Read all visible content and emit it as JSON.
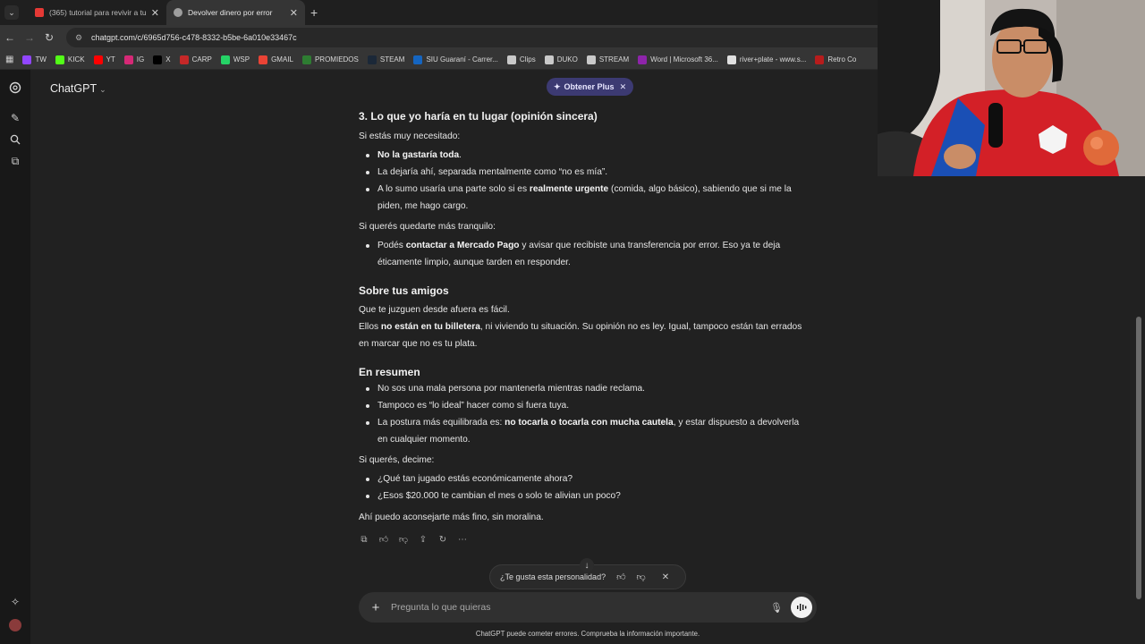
{
  "browser": {
    "tabs": [
      {
        "title": "(365) tutorial para revivir a tu h",
        "favicon_color": "#e53935",
        "active": false
      },
      {
        "title": "Devolver dinero por error",
        "favicon_color": "#9e9e9e",
        "active": true
      }
    ],
    "new_tab": "+",
    "url": "chatgpt.com/c/6965d756-c478-8332-b5be-6a010e33467c",
    "bookmarks": [
      {
        "label": "TW",
        "color": "#9146ff"
      },
      {
        "label": "KICK",
        "color": "#53fc18"
      },
      {
        "label": "YT",
        "color": "#ff0000"
      },
      {
        "label": "IG",
        "color": "#d62976"
      },
      {
        "label": "X",
        "color": "#000000"
      },
      {
        "label": "CARP",
        "color": "#c62828"
      },
      {
        "label": "WSP",
        "color": "#25d366"
      },
      {
        "label": "GMAIL",
        "color": "#ea4335"
      },
      {
        "label": "PROMIEDOS",
        "color": "#2e7d32"
      },
      {
        "label": "STEAM",
        "color": "#1b2838"
      },
      {
        "label": "SIU Guaraní - Carrer...",
        "color": "#1565c0"
      },
      {
        "label": "Clips",
        "color": "#c9c9c9"
      },
      {
        "label": "DUKO",
        "color": "#c9c9c9"
      },
      {
        "label": "STREAM",
        "color": "#c9c9c9"
      },
      {
        "label": "Word | Microsoft 36...",
        "color": "#8e24aa"
      },
      {
        "label": "river+plate - www.s...",
        "color": "#e0e0e0"
      },
      {
        "label": "Retro Co",
        "color": "#b71c1c"
      }
    ]
  },
  "app": {
    "model": "ChatGPT",
    "plus_badge": "Obtener Plus"
  },
  "message": {
    "s1_title": "3. Lo que yo haría en tu lugar (opinión sincera)",
    "s1_intro": "Si estás muy necesitado:",
    "s1_b1": "No la gastaría toda",
    "s1_b2": "La dejaría ahí, separada mentalmente como “no es mía”.",
    "s1_b3a": "A lo sumo usaría una parte solo si es ",
    "s1_b3b": "realmente urgente",
    "s1_b3c": " (comida, algo básico), sabiendo que si me la",
    "s1_b3d": "piden, me hago cargo.",
    "s1_intro2": "Si querés quedarte más tranquilo:",
    "s1_b4a": "Podés ",
    "s1_b4b": "contactar a Mercado Pago",
    "s1_b4c": " y avisar que recibiste una transferencia por error. Eso ya te deja",
    "s1_b4d": "éticamente limpio, aunque tarden en responder.",
    "s2_title": "Sobre tus amigos",
    "s2_p1": "Que te juzguen desde afuera es fácil.",
    "s2_p2a": "Ellos ",
    "s2_p2b": "no están en tu billetera",
    "s2_p2c": ", ni viviendo tu situación. Su opinión no es ley. Igual, tampoco están tan errados",
    "s2_p2d": "en marcar que no es tu plata.",
    "s3_title": "En resumen",
    "s3_b1": "No sos una mala persona por mantenerla mientras nadie reclama.",
    "s3_b2": "Tampoco es “lo ideal” hacer como si fuera tuya.",
    "s3_b3a": "La postura más equilibrada es: ",
    "s3_b3b": "no tocarla o tocarla con mucha cautela",
    "s3_b3c": ", y estar dispuesto a devolverla",
    "s3_b3d": "en cualquier momento.",
    "s4_intro": "Si querés, decime:",
    "s4_b1": "¿Qué tan jugado estás económicamente ahora?",
    "s4_b2": "¿Esos $20.000 te cambian el mes o solo te alivian un poco?",
    "s4_close": "Ahí puedo aconsejarte más fino, sin moralina."
  },
  "feedback": {
    "question": "¿Te gusta esta personalidad?"
  },
  "composer": {
    "placeholder": "Pregunta lo que quieras"
  },
  "footer": {
    "disclaimer": "ChatGPT puede cometer errores. Comprueba la información importante."
  },
  "colors": {
    "accent_plus": "#3c3a72",
    "background": "#212121",
    "sidebar": "#181818"
  }
}
